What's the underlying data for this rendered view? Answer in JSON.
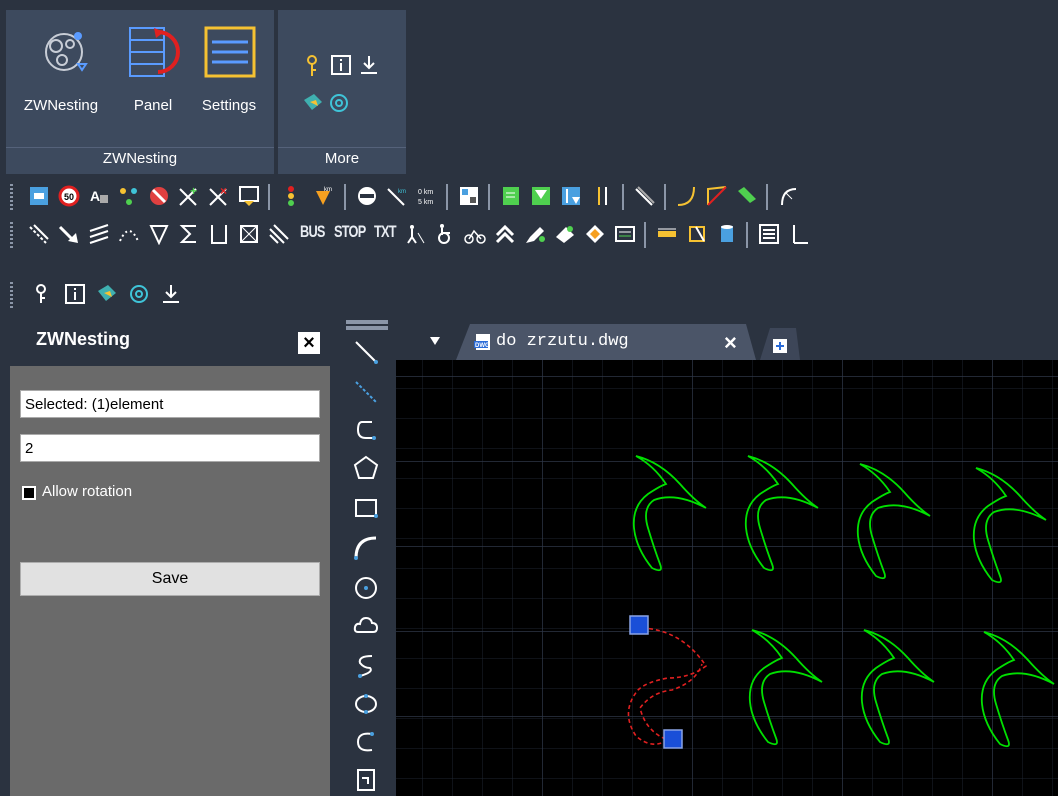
{
  "ribbon": {
    "groups": [
      {
        "label": "ZWNesting",
        "buttons": [
          {
            "label": "ZWNesting"
          },
          {
            "label": "Panel"
          },
          {
            "label": "Settings"
          }
        ]
      },
      {
        "label": "More"
      }
    ]
  },
  "toolbar2": {
    "text_buttons": [
      "BUS",
      "STOP",
      "TXT"
    ]
  },
  "panel": {
    "title": "ZWNesting",
    "close_glyph": "×",
    "selected_value": "Selected: (1)element",
    "count_value": "2",
    "allow_rotation_label": "Allow rotation",
    "allow_rotation_checked": false,
    "save_label": "Save"
  },
  "tabs": [
    {
      "label": "do zrzutu.dwg",
      "active": true,
      "close_glyph": "×"
    }
  ],
  "draw_tools": [
    "line-icon",
    "ray-icon",
    "polyline-icon",
    "polygon-icon",
    "rectangle-icon",
    "arc-icon",
    "circle-icon",
    "cloud-icon",
    "spline-icon",
    "ellipse-icon",
    "ellipse-arc-icon",
    "insert-block-icon"
  ],
  "colors": {
    "shape": "#00e000",
    "selected": "#e02020",
    "grip": "#1a4fd8",
    "accent": "#f6c232"
  }
}
